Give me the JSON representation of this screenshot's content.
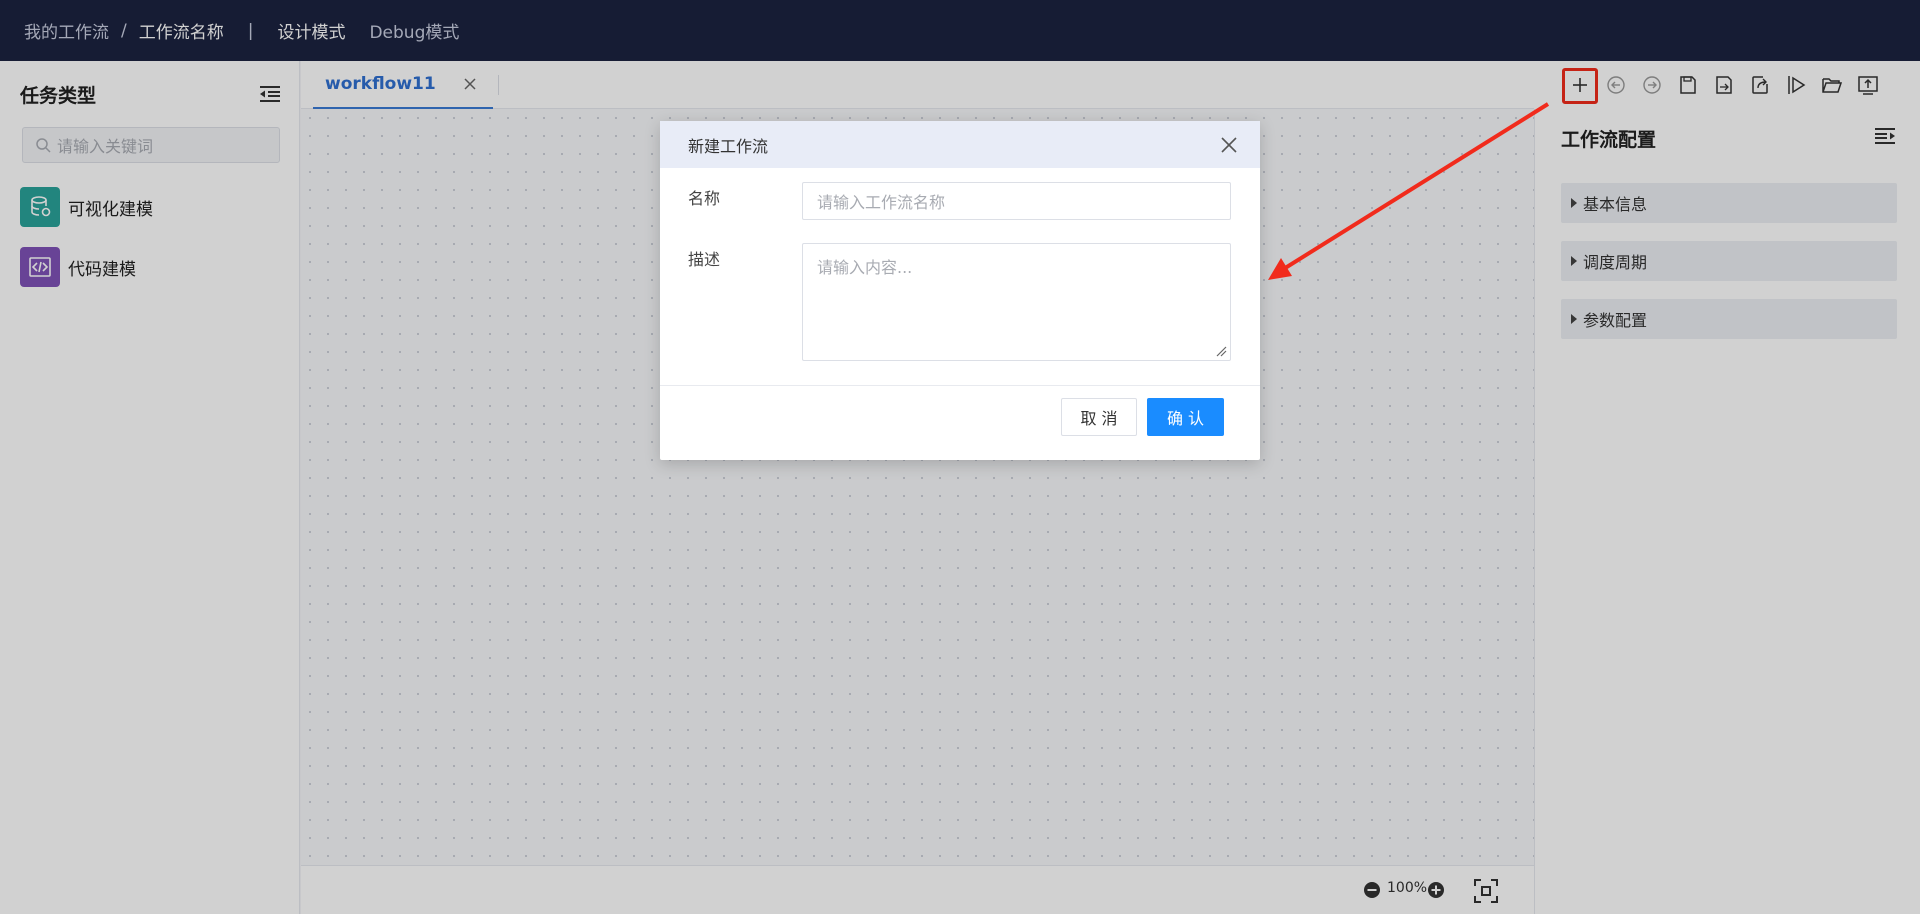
{
  "topbar": {
    "crumbs": [
      "我的工作流",
      "工作流名称"
    ],
    "crumb_separator": "/",
    "divider": "|",
    "modes": [
      "设计模式",
      "Debug模式"
    ]
  },
  "left": {
    "title": "任务类型",
    "search_placeholder": "请输入关键词",
    "items": [
      {
        "label": "可视化建模",
        "icon": "database-icon",
        "color": "#2aa39a"
      },
      {
        "label": "代码建模",
        "icon": "code-icon",
        "color": "#7f52b8"
      }
    ]
  },
  "tabs": [
    {
      "label": "workflow11"
    }
  ],
  "zoom": {
    "level": "100%"
  },
  "right": {
    "title": "工作流配置",
    "sections": [
      "基本信息",
      "调度周期",
      "参数配置"
    ]
  },
  "dialog": {
    "title": "新建工作流",
    "name_label": "名称",
    "name_placeholder": "请输入工作流名称",
    "desc_label": "描述",
    "desc_placeholder": "请输入内容...",
    "cancel": "取 消",
    "confirm": "确 认"
  },
  "colors": {
    "topbar": "#1c2340",
    "accent": "#1a8cff",
    "highlight": "#f12b1c"
  }
}
